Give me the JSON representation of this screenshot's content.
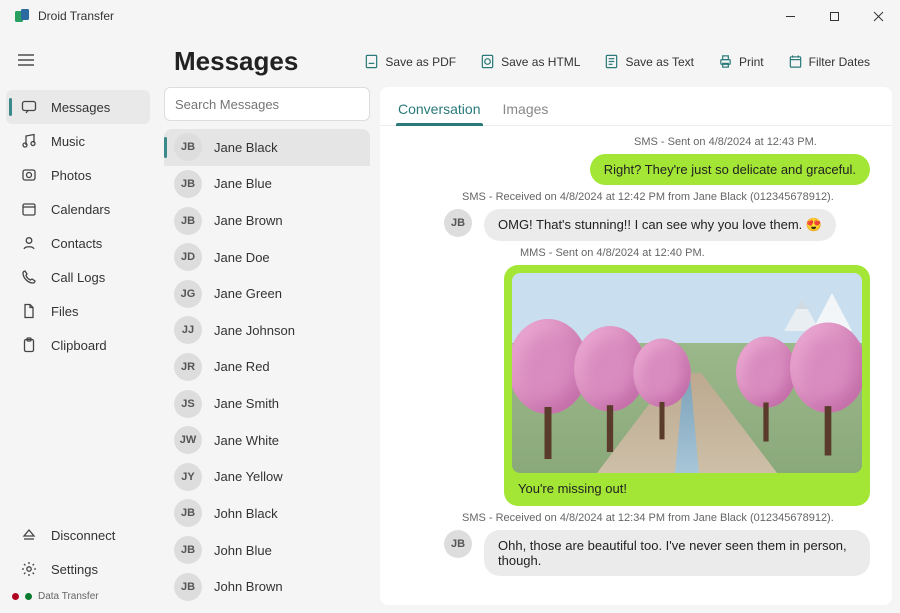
{
  "app": {
    "title": "Droid Transfer"
  },
  "sidebar": {
    "items": [
      {
        "label": "Messages",
        "icon": "chat"
      },
      {
        "label": "Music",
        "icon": "music"
      },
      {
        "label": "Photos",
        "icon": "photo"
      },
      {
        "label": "Calendars",
        "icon": "calendar"
      },
      {
        "label": "Contacts",
        "icon": "contact"
      },
      {
        "label": "Call Logs",
        "icon": "phone"
      },
      {
        "label": "Files",
        "icon": "file"
      },
      {
        "label": "Clipboard",
        "icon": "clipboard"
      }
    ],
    "bottom": [
      {
        "label": "Disconnect",
        "icon": "eject"
      },
      {
        "label": "Settings",
        "icon": "gear"
      }
    ]
  },
  "status": {
    "label": "Data Transfer",
    "dot1": "#b00020",
    "dot2": "#0a7a2f"
  },
  "header": {
    "title": "Messages"
  },
  "toolbar": {
    "pdf": "Save as PDF",
    "html": "Save as HTML",
    "text": "Save as Text",
    "print": "Print",
    "filter": "Filter Dates"
  },
  "search": {
    "placeholder": "Search Messages"
  },
  "contacts": [
    {
      "initials": "JB",
      "name": "Jane Black",
      "selected": true
    },
    {
      "initials": "JB",
      "name": "Jane Blue"
    },
    {
      "initials": "JB",
      "name": "Jane Brown"
    },
    {
      "initials": "JD",
      "name": "Jane Doe"
    },
    {
      "initials": "JG",
      "name": "Jane Green"
    },
    {
      "initials": "JJ",
      "name": "Jane Johnson"
    },
    {
      "initials": "JR",
      "name": "Jane Red"
    },
    {
      "initials": "JS",
      "name": "Jane Smith"
    },
    {
      "initials": "JW",
      "name": "Jane White"
    },
    {
      "initials": "JY",
      "name": "Jane Yellow"
    },
    {
      "initials": "JB",
      "name": "John Black"
    },
    {
      "initials": "JB",
      "name": "John Blue"
    },
    {
      "initials": "JB",
      "name": "John Brown"
    }
  ],
  "tabs": {
    "conversation": "Conversation",
    "images": "Images"
  },
  "messages": {
    "m1_meta": "SMS - Sent on 4/8/2024 at 12:43 PM.",
    "m1_text": "Right? They're just so delicate and graceful.",
    "m2_meta": "SMS - Received on 4/8/2024 at 12:42 PM from Jane Black (012345678912).",
    "m2_text": "OMG! That's stunning!! I can see why you love them. 😍",
    "m2_initials": "JB",
    "m3_meta": "MMS - Sent on 4/8/2024 at 12:40 PM.",
    "m3_caption": "You're missing out!",
    "m4_meta": "SMS - Received on 4/8/2024 at 12:34 PM from Jane Black (012345678912).",
    "m4_text": "Ohh, those are beautiful too. I've never seen them in person, though.",
    "m4_initials": "JB"
  }
}
